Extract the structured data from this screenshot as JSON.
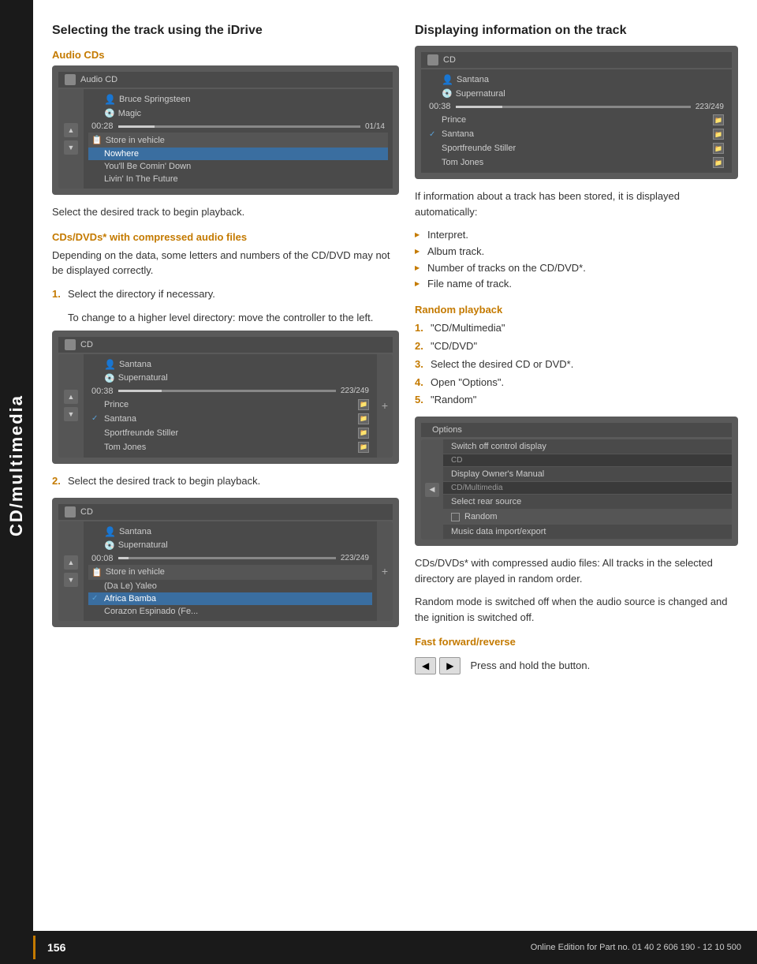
{
  "sidebar": {
    "label": "CD/multimedia"
  },
  "left_column": {
    "section_title": "Selecting the track using the iDrive",
    "audio_cds_label": "Audio CDs",
    "screen1": {
      "header": "Audio CD",
      "artist": "Bruce Springsteen",
      "album": "Magic",
      "time": "00:28",
      "track_num": "01/14",
      "store_label": "Store in vehicle",
      "tracks": [
        "Nowhere",
        "You'll Be Comin' Down",
        "Livin' In The Future"
      ]
    },
    "para1": "Select the desired track to begin playback.",
    "compressed_title": "CDs/DVDs* with compressed audio files",
    "compressed_para": "Depending on the data, some letters and numbers of the CD/DVD may not be displayed correctly.",
    "steps1": [
      {
        "num": "1.",
        "text": "Select the directory if necessary."
      }
    ],
    "indent1": "To change to a higher level directory: move the controller to the left.",
    "screen2": {
      "header": "CD",
      "artist": "Santana",
      "album": "Supernatural",
      "time": "00:38",
      "track_count": "223/249",
      "tracks": [
        {
          "name": "Prince",
          "checked": false
        },
        {
          "name": "Santana",
          "checked": true
        },
        {
          "name": "Sportfreunde Stiller",
          "checked": false
        },
        {
          "name": "Tom Jones",
          "checked": false
        }
      ]
    },
    "step2": {
      "num": "2.",
      "text": "Select the desired track to begin playback."
    },
    "screen3": {
      "header": "CD",
      "artist": "Santana",
      "album": "Supernatural",
      "time": "00:08",
      "track_count": "223/249",
      "store_label": "Store in vehicle",
      "tracks": [
        {
          "name": "(Da Le) Yaleo",
          "checked": false
        },
        {
          "name": "Africa Bamba",
          "checked": true
        },
        {
          "name": "Corazon Espinado (Fe...",
          "checked": false
        }
      ]
    }
  },
  "right_column": {
    "display_title": "Displaying information on the track",
    "screen_display": {
      "header": "CD",
      "artist": "Santana",
      "album": "Supernatural",
      "time": "00:38",
      "track_count": "223/249",
      "tracks": [
        {
          "name": "Prince",
          "checked": false
        },
        {
          "name": "Santana",
          "checked": true
        },
        {
          "name": "Sportfreunde Stiller",
          "checked": false
        },
        {
          "name": "Tom Jones",
          "checked": false
        }
      ]
    },
    "display_para": "If information about a track has been stored, it is displayed automatically:",
    "display_bullets": [
      "Interpret.",
      "Album track.",
      "Number of tracks on the CD/DVD*.",
      "File name of track."
    ],
    "random_title": "Random playback",
    "random_steps": [
      {
        "num": "1.",
        "text": "\"CD/Multimedia\""
      },
      {
        "num": "2.",
        "text": "\"CD/DVD\""
      },
      {
        "num": "3.",
        "text": "Select the desired CD or DVD*."
      },
      {
        "num": "4.",
        "text": "Open \"Options\"."
      },
      {
        "num": "5.",
        "text": "\"Random\""
      }
    ],
    "options_screen": {
      "header": "Options",
      "rows": [
        {
          "type": "item",
          "text": "Switch off control display"
        },
        {
          "type": "section",
          "text": "CD"
        },
        {
          "type": "item",
          "text": "Display Owner's Manual"
        },
        {
          "type": "section",
          "text": "CD/Multimedia"
        },
        {
          "type": "item",
          "text": "Select rear source"
        },
        {
          "type": "checkbox",
          "text": "Random"
        },
        {
          "type": "item",
          "text": "Music data import/export"
        }
      ]
    },
    "random_para1": "CDs/DVDs* with compressed audio files: All tracks in the selected directory are played in random order.",
    "random_para2": "Random mode is switched off when the audio source is changed and the ignition is switched off.",
    "ff_title": "Fast forward/reverse",
    "ff_para": "Press and hold the button."
  },
  "footer": {
    "page_number": "156",
    "footer_text": "Online Edition for Part no. 01 40 2 606 190 - 12 10 500"
  }
}
